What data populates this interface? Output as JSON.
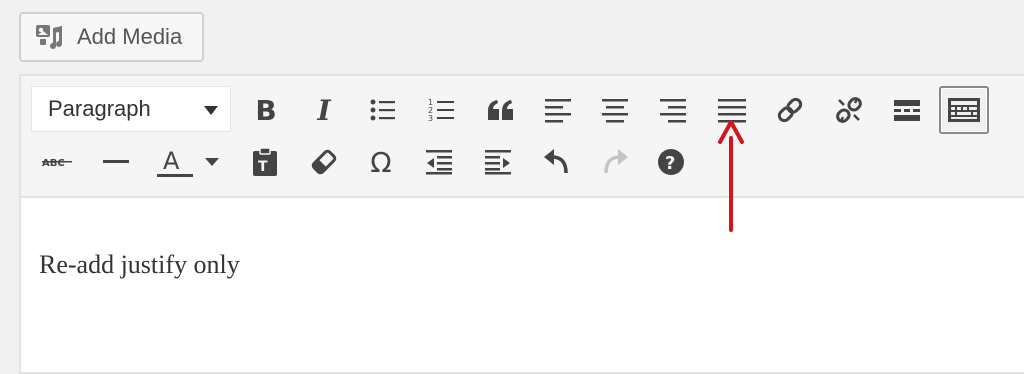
{
  "add_media": {
    "label": "Add Media",
    "icon": "media-icon"
  },
  "toolbar": {
    "format_select": {
      "value": "Paragraph"
    },
    "row1": [
      "bold",
      "italic",
      "bullet-list",
      "numbered-list",
      "blockquote",
      "align-left",
      "align-center",
      "align-right",
      "align-justify",
      "insert-link",
      "remove-link",
      "read-more",
      "toolbar-toggle"
    ],
    "row2": [
      "strikethrough",
      "horizontal-line",
      "text-color",
      "paste-as-text",
      "clear-formatting",
      "special-character",
      "decrease-indent",
      "increase-indent",
      "undo",
      "redo",
      "keyboard-shortcuts"
    ],
    "active": "toolbar-toggle",
    "highlighted": "align-justify"
  },
  "editor": {
    "content": "Re-add justify only"
  },
  "annotation": {
    "color": "#d4161c"
  }
}
